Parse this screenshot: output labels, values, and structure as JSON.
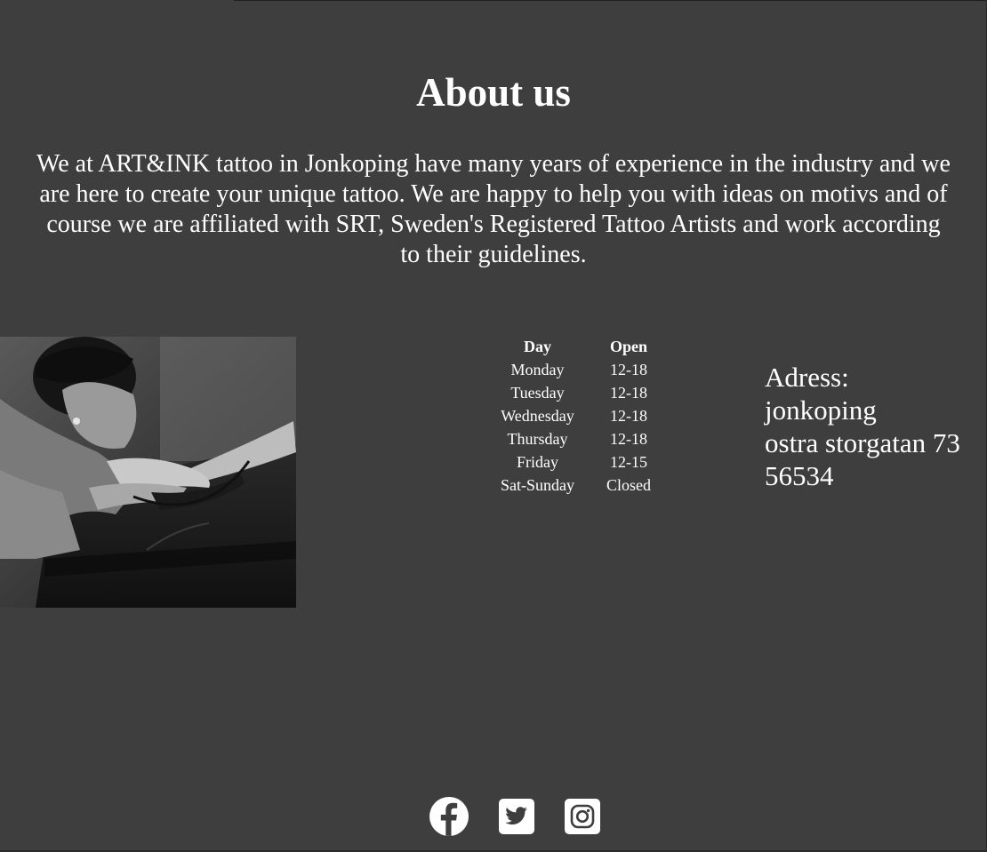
{
  "about": {
    "title": "About us",
    "description": "We at ART&INK tattoo in Jonkoping have many years of experience in the industry and we are here to create your unique tattoo. We are happy to help you with ideas on motivs and of course we are affiliated with SRT, Sweden's Registered Tattoo Artists and work according to their guidelines."
  },
  "hours": {
    "headers": {
      "day": "Day",
      "open": "Open"
    },
    "rows": [
      {
        "day": "Monday",
        "open": "12-18"
      },
      {
        "day": "Tuesday",
        "open": "12-18"
      },
      {
        "day": "Wednesday",
        "open": "12-18"
      },
      {
        "day": "Thursday",
        "open": "12-18"
      },
      {
        "day": "Friday",
        "open": "12-15"
      },
      {
        "day": "Sat-Sunday",
        "open": "Closed"
      }
    ]
  },
  "address": {
    "label": "Adress:",
    "city": "jonkoping",
    "street": "ostra storgatan 73",
    "zip": "56534"
  },
  "social": {
    "icons": [
      "facebook-icon",
      "twitter-icon",
      "instagram-icon"
    ]
  },
  "colors": {
    "background": "#3e3e3e",
    "text": "#ffffff"
  }
}
